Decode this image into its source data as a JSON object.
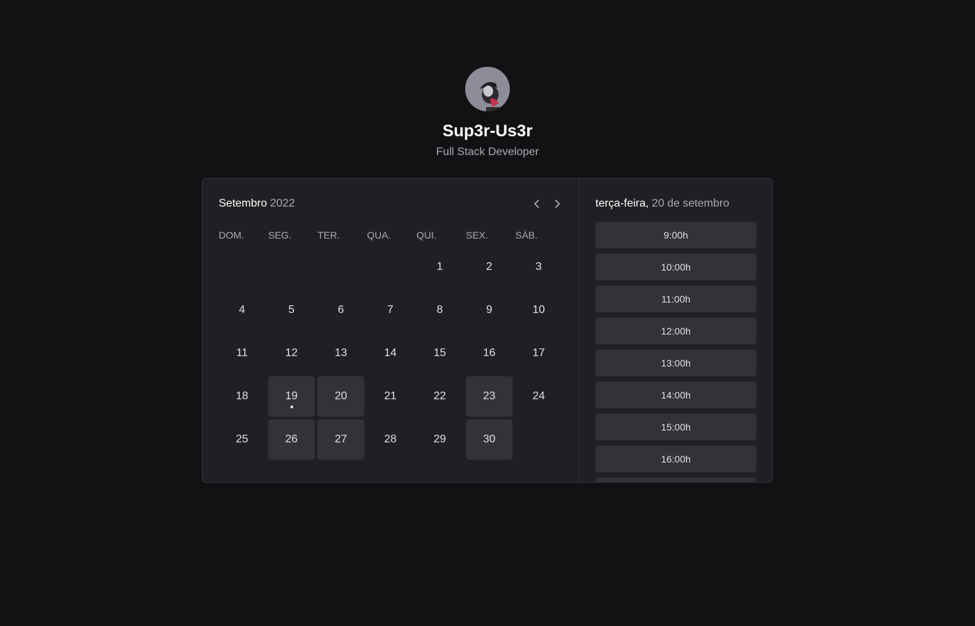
{
  "profile": {
    "name": "Sup3r-Us3r",
    "role": "Full Stack Developer"
  },
  "calendar": {
    "month": "Setembro",
    "year": "2022",
    "weekdays": [
      "DOM.",
      "SEG.",
      "TER.",
      "QUA.",
      "QUI.",
      "SEX.",
      "SÁB."
    ],
    "weeks": [
      [
        null,
        null,
        null,
        null,
        {
          "day": "1"
        },
        {
          "day": "2"
        },
        {
          "day": "3"
        }
      ],
      [
        {
          "day": "4"
        },
        {
          "day": "5"
        },
        {
          "day": "6"
        },
        {
          "day": "7"
        },
        {
          "day": "8"
        },
        {
          "day": "9"
        },
        {
          "day": "10"
        }
      ],
      [
        {
          "day": "11"
        },
        {
          "day": "12"
        },
        {
          "day": "13"
        },
        {
          "day": "14"
        },
        {
          "day": "15"
        },
        {
          "day": "16"
        },
        {
          "day": "17"
        }
      ],
      [
        {
          "day": "18"
        },
        {
          "day": "19",
          "available": true,
          "today": true
        },
        {
          "day": "20",
          "available": true
        },
        {
          "day": "21"
        },
        {
          "day": "22"
        },
        {
          "day": "23",
          "available": true
        },
        {
          "day": "24"
        }
      ],
      [
        {
          "day": "25"
        },
        {
          "day": "26",
          "available": true
        },
        {
          "day": "27",
          "available": true
        },
        {
          "day": "28"
        },
        {
          "day": "29"
        },
        {
          "day": "30",
          "available": true
        },
        null
      ]
    ]
  },
  "times": {
    "weekday": "terça-feira,",
    "date": "20 de setembro",
    "slots": [
      "9:00h",
      "10:00h",
      "11:00h",
      "12:00h",
      "13:00h",
      "14:00h",
      "15:00h",
      "16:00h",
      ""
    ]
  },
  "colors": {
    "background": "#121214",
    "panel": "#202024",
    "available": "#323238"
  }
}
